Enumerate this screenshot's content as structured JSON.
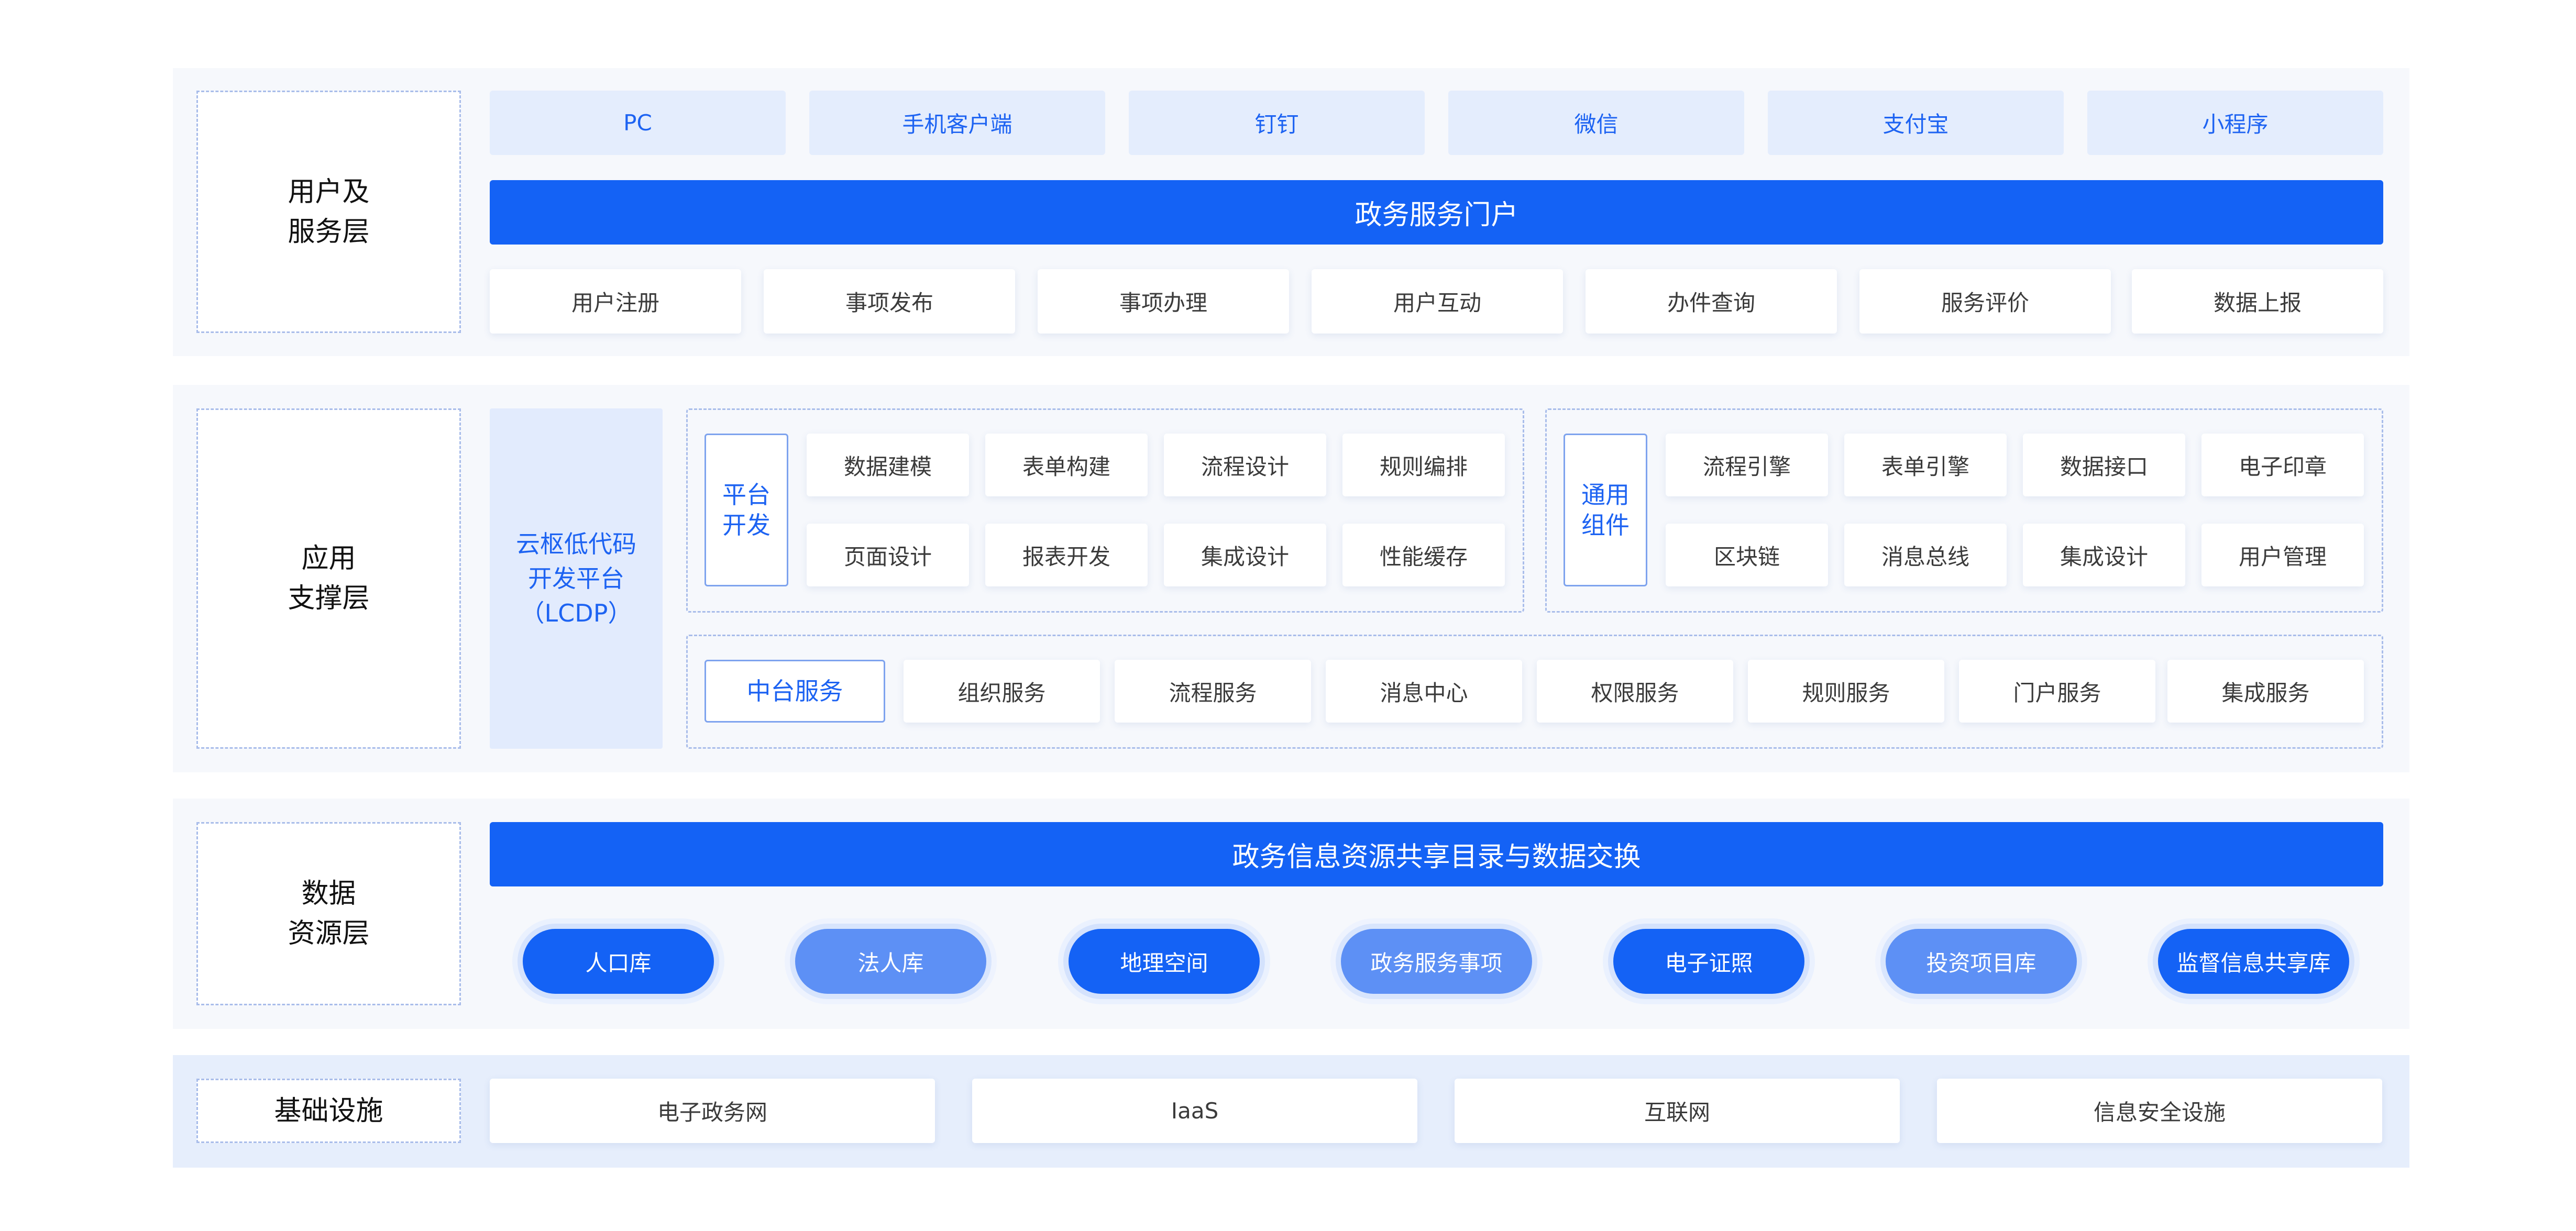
{
  "layers": {
    "user": {
      "label": "用户及\n服务层",
      "channels": [
        "PC",
        "手机客户端",
        "钉钉",
        "微信",
        "支付宝",
        "小程序"
      ],
      "portal": "政务服务门户",
      "services": [
        "用户注册",
        "事项发布",
        "事项办理",
        "用户互动",
        "办件查询",
        "服务评价",
        "数据上报"
      ]
    },
    "app": {
      "label": "应用\n支撑层",
      "lcdp": "云枢低代码\n开发平台\n（LCDP）",
      "platform_dev": {
        "label": "平台\n开发",
        "items": [
          "数据建模",
          "表单构建",
          "流程设计",
          "规则编排",
          "页面设计",
          "报表开发",
          "集成设计",
          "性能缓存"
        ]
      },
      "common": {
        "label": "通用\n组件",
        "items": [
          "流程引擎",
          "表单引擎",
          "数据接口",
          "电子印章",
          "区块链",
          "消息总线",
          "集成设计",
          "用户管理"
        ]
      },
      "middle": {
        "label": "中台服务",
        "items": [
          "组织服务",
          "流程服务",
          "消息中心",
          "权限服务",
          "规则服务",
          "门户服务",
          "集成服务"
        ]
      }
    },
    "data": {
      "label": "数据\n资源层",
      "exchange": "政务信息资源共享目录与数据交换",
      "libraries": [
        "人口库",
        "法人库",
        "地理空间",
        "政务服务事项",
        "电子证照",
        "投资项目库",
        "监督信息共享库"
      ]
    },
    "infra": {
      "label": "基础设施",
      "items": [
        "电子政务网",
        "IaaS",
        "互联网",
        "信息安全设施"
      ]
    }
  },
  "colors": {
    "primary": "#1462f5",
    "primary_light": "#5d90f5",
    "channel_bg": "#e4edfd",
    "dashed_border": "#a9bdea"
  }
}
